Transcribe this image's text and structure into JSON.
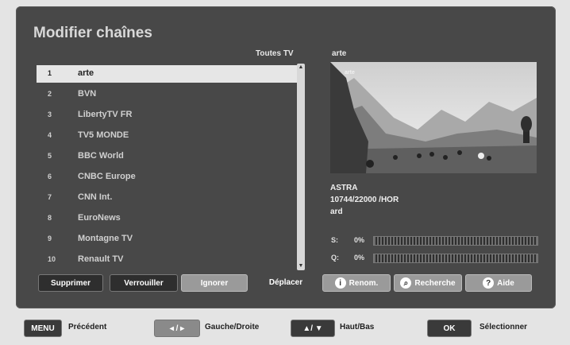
{
  "header": {
    "title": "Modifier chaînes",
    "category": "Toutes TV",
    "selected_channel": "arte"
  },
  "channels": [
    {
      "num": "1",
      "name": "arte",
      "selected": true
    },
    {
      "num": "2",
      "name": "BVN"
    },
    {
      "num": "3",
      "name": "LibertyTV FR"
    },
    {
      "num": "4",
      "name": "TV5 MONDE"
    },
    {
      "num": "5",
      "name": "BBC World"
    },
    {
      "num": "6",
      "name": "CNBC Europe"
    },
    {
      "num": "7",
      "name": "CNN Int."
    },
    {
      "num": "8",
      "name": "EuroNews"
    },
    {
      "num": "9",
      "name": "Montagne TV"
    },
    {
      "num": "10",
      "name": "Renault TV"
    }
  ],
  "preview": {
    "logo": "arte"
  },
  "info": {
    "satellite": "ASTRA",
    "transponder": "10744/22000 /HOR",
    "provider": "ard"
  },
  "signal": {
    "strength_label": "S:",
    "strength_value": "0%",
    "quality_label": "Q:",
    "quality_value": "0%"
  },
  "actions": {
    "delete": "Supprimer",
    "lock": "Verrouiller",
    "ignore": "Ignorer",
    "move": "Déplacer",
    "rename": "Renom.",
    "search": "Recherche",
    "help": "Aide"
  },
  "footer": {
    "menu_key": "MENU",
    "menu_label": "Précédent",
    "lr_key": "◂ / ▸",
    "lr_label": "Gauche/Droite",
    "ud_key": "▲/ ▼",
    "ud_label": "Haut/Bas",
    "ok_key": "OK",
    "ok_label": "Sélectionner"
  }
}
